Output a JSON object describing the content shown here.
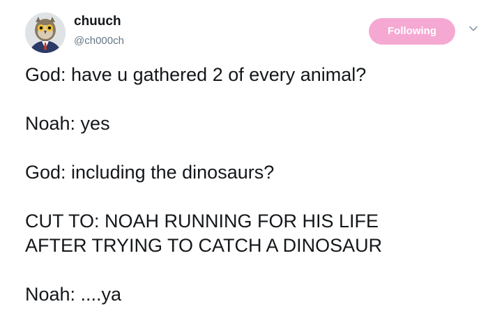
{
  "author": {
    "display_name": "chuuch",
    "handle": "@ch000ch",
    "avatar_icon": "owl-in-suit-avatar"
  },
  "follow_button": {
    "label": "Following",
    "color": "#f5a9d2"
  },
  "menu": {
    "icon": "chevron-down-icon"
  },
  "tweet": {
    "lines": [
      "God: have u gathered 2 of every animal?",
      "Noah: yes",
      "God: including the dinosaurs?",
      "CUT TO: NOAH RUNNING FOR HIS LIFE\nAFTER TRYING TO CATCH A DINOSAUR",
      "Noah: ....ya"
    ]
  }
}
